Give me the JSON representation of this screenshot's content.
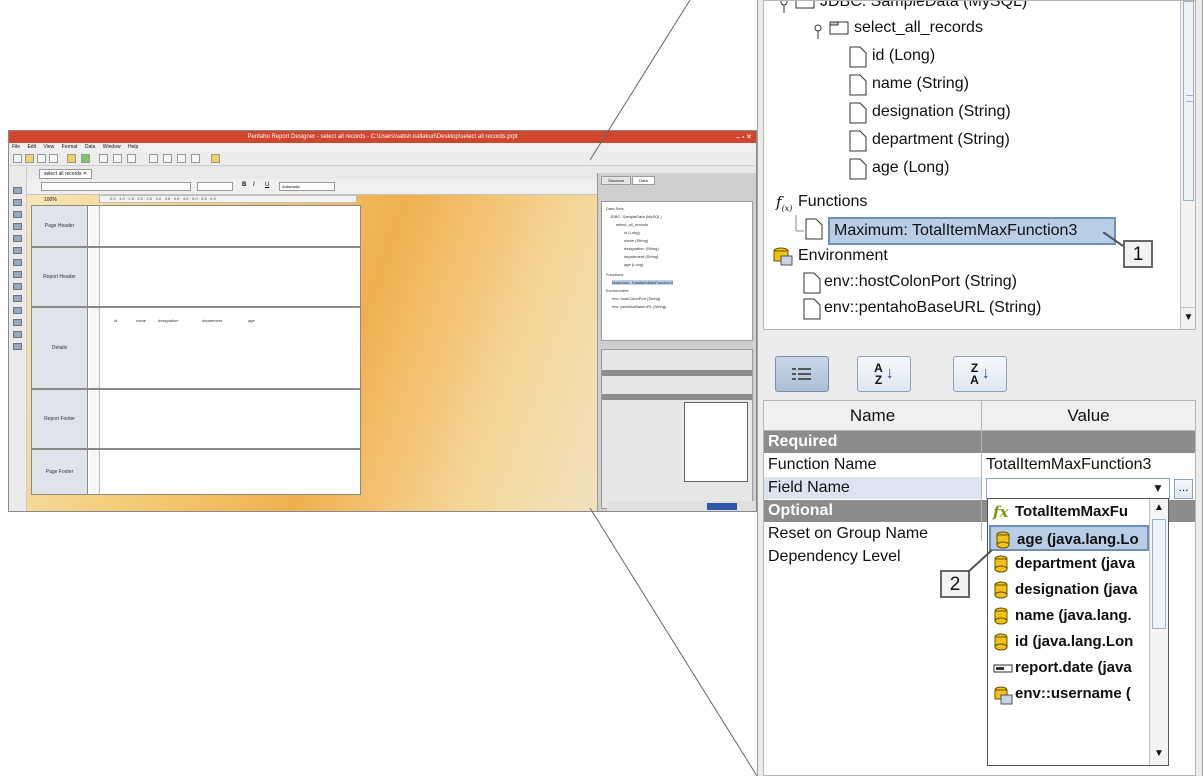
{
  "overview": {
    "title": "Pentaho Report Designer - select all records - C:\\Users\\satish.kallakuri\\Desktop\\select all records.prpt",
    "menus": [
      "File",
      "Edit",
      "View",
      "Format",
      "Data",
      "Window",
      "Help"
    ],
    "tab_label": "select all records",
    "zoom_label": "100%",
    "format_font": "Automatic",
    "ruler": "0.0 · 1.0 · 1.5 · 2.0 · 2.5 · 3.0 · 3.5 · 4.0 · 4.5 · 5.0 · 5.5 · 6.0",
    "bands": [
      "Page Header",
      "Report Header",
      "Details",
      "Report Footer",
      "Page Footer"
    ],
    "detail_columns": [
      "id",
      "name",
      "designation",
      "department",
      "age"
    ],
    "side_tabs": [
      "Structure",
      "Data"
    ],
    "tree_lines": [
      "Data Sets",
      "JDBC: SampleData (MySQL)",
      "select_all_records",
      "id (Long)",
      "name (String)",
      "designation (String)",
      "department (String)",
      "age (Long)",
      "Functions",
      "Maximum: TotalItemMaxFunction3",
      "Environment",
      "env::hostColonPort (String)",
      "env::pentahoBaseURL (String)"
    ]
  },
  "tree": {
    "items": [
      {
        "label": "JDBC: SampleData (MySQL)"
      },
      {
        "label": "select_all_records"
      },
      {
        "label": "id (Long)"
      },
      {
        "label": "name (String)"
      },
      {
        "label": "designation (String)"
      },
      {
        "label": "department (String)"
      },
      {
        "label": "age (Long)"
      },
      {
        "label": "Functions"
      },
      {
        "label": "Maximum: TotalItemMaxFunction3"
      },
      {
        "label": "Environment"
      },
      {
        "label": "env::hostColonPort (String)"
      },
      {
        "label": "env::pentahoBaseURL (String)"
      }
    ]
  },
  "callouts": {
    "one": "1",
    "two": "2"
  },
  "sort_buttons": {
    "category": "≡",
    "az": "A↓Z",
    "za": "Z↓A"
  },
  "properties": {
    "col_name": "Name",
    "col_value": "Value",
    "required_label": "Required",
    "function_name_label": "Function Name",
    "function_name_value": "TotalItemMaxFunction3",
    "field_name_label": "Field Name",
    "optional_label": "Optional",
    "reset_label": "Reset on Group Name",
    "dependency_label": "Dependency Level",
    "ellipsis": "..."
  },
  "dropdown": {
    "items": [
      {
        "label": "TotalItemMaxFu",
        "icon": "function-icon"
      },
      {
        "label": "age (java.lang.Lo",
        "icon": "column-icon"
      },
      {
        "label": "department (java",
        "icon": "column-icon"
      },
      {
        "label": "designation (java",
        "icon": "column-icon"
      },
      {
        "label": "name (java.lang.",
        "icon": "column-icon"
      },
      {
        "label": "id (java.lang.Lon",
        "icon": "column-icon"
      },
      {
        "label": "report.date (java",
        "icon": "field-icon"
      },
      {
        "label": "env::username (",
        "icon": "environment-icon"
      }
    ]
  },
  "colors": {
    "selection": "#b8cde6",
    "group_header": "#8c8c8c",
    "title_bar": "#d2452f"
  }
}
